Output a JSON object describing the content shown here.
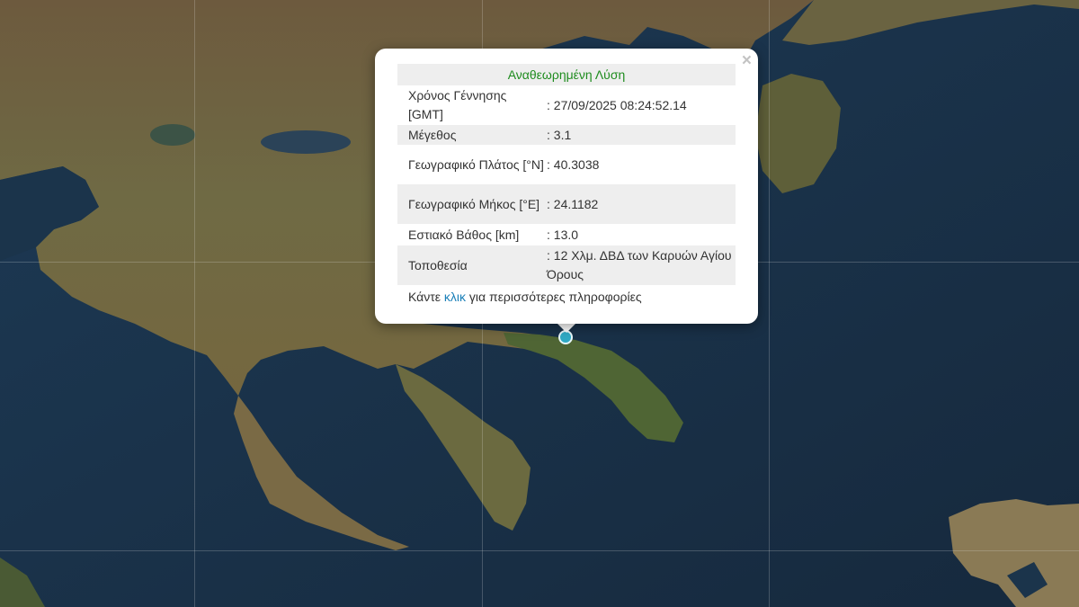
{
  "popup": {
    "title": "Αναθεωρημένη Λύση",
    "close": "×",
    "rows": [
      {
        "label": "Χρόνος Γέννησης [GMT]",
        "value": ": 27/09/2025 08:24:52.14"
      },
      {
        "label": "Μέγεθος",
        "value": ": 3.1"
      },
      {
        "label": "Γεωγραφικό Πλάτος [°N]",
        "value": ": 40.3038"
      },
      {
        "label": "Γεωγραφικό Μήκος [°E]",
        "value": ": 24.1182"
      },
      {
        "label": "Εστιακό Βάθος [km]",
        "value": ": 13.0"
      },
      {
        "label": "Τοποθεσία",
        "value": ": 12 Χλμ. ΔΒΔ των Καρυών Αγίου Όρους"
      }
    ],
    "more_prefix": "Κάντε ",
    "more_link": "κλικ",
    "more_suffix": " για περισσότερες πληροφορίες"
  },
  "marker": {
    "icon": "earthquake-epicenter-marker",
    "color": "#2fa9c4"
  },
  "colors": {
    "title_green": "#1e8c1e",
    "link_blue": "#1a7fb8",
    "sea": "#1c3247",
    "land": "#6e6a44"
  }
}
